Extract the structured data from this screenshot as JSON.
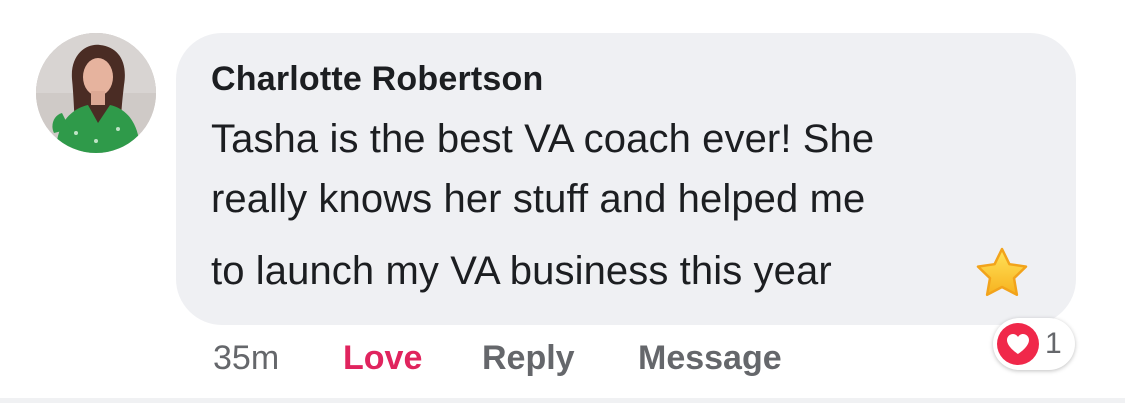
{
  "comment": {
    "author": "Charlotte Robertson",
    "text_lines": [
      "Tasha is the best VA coach ever! She",
      "really knows her stuff and helped me",
      "to launch my VA business this year"
    ],
    "emoji_icon": "star-icon"
  },
  "actions": {
    "time": "35m",
    "love_label": "Love",
    "reply_label": "Reply",
    "message_label": "Message"
  },
  "reactions": {
    "icon": "heart-icon",
    "count": "1"
  },
  "colors": {
    "bubble": "#eff0f3",
    "text": "#1c1e21",
    "meta": "#65676b",
    "love": "#e0245e",
    "heart_badge": "#f0284a"
  }
}
